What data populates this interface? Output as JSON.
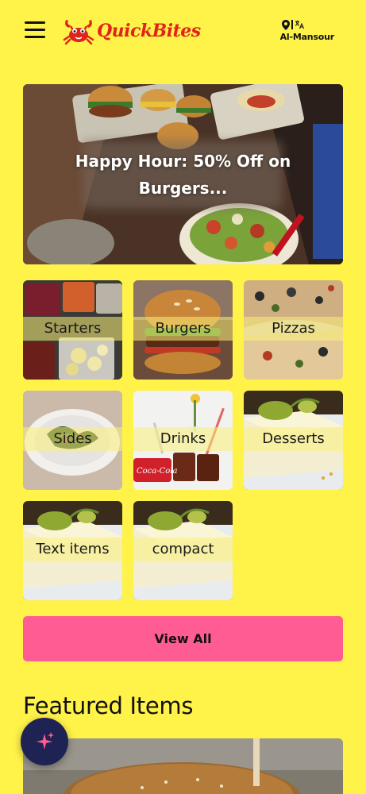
{
  "app": {
    "name": "QuickBites"
  },
  "header": {
    "location": "Al-Mansour"
  },
  "banner": {
    "text": "Happy Hour: 50% Off on Burgers..."
  },
  "categories": [
    {
      "label": "Starters"
    },
    {
      "label": "Burgers"
    },
    {
      "label": "Pizzas"
    },
    {
      "label": "Sides"
    },
    {
      "label": "Drinks"
    },
    {
      "label": "Desserts"
    },
    {
      "label": "Text items"
    },
    {
      "label": "compact"
    }
  ],
  "actions": {
    "view_all": "View All"
  },
  "featured": {
    "title": "Featured Items"
  },
  "icons": {
    "menu": "hamburger-menu-icon",
    "location": "map-pin-icon",
    "language": "translate-icon",
    "ai": "sparkles-icon"
  },
  "colors": {
    "background": "#fff249",
    "brand": "#e0241c",
    "view_all": "#ff5c93",
    "fab": "#1f2354"
  }
}
